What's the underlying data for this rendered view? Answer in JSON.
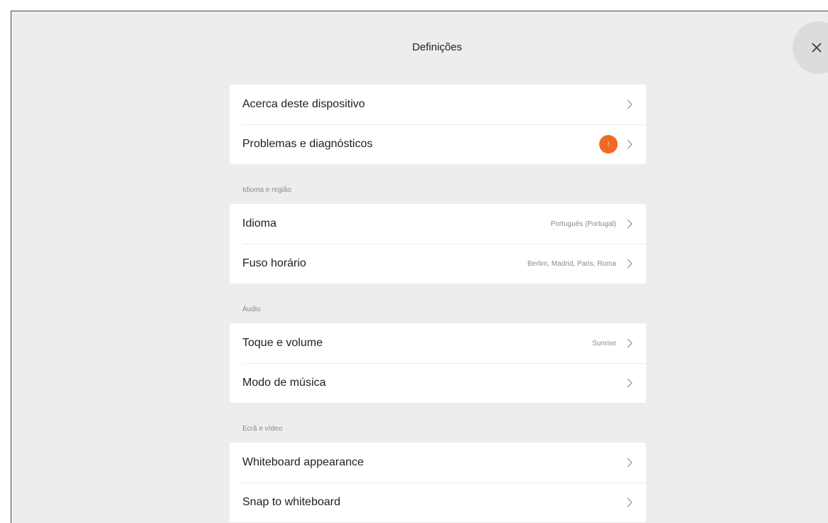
{
  "dialog": {
    "title": "Definições",
    "close_icon": "close-icon"
  },
  "groups": [
    {
      "header": "",
      "rows": [
        {
          "label": "Acerca deste dispositivo",
          "value": ""
        },
        {
          "label": "Problemas e diagnósticos",
          "value": "",
          "badge": "!"
        }
      ]
    },
    {
      "header": "Idioma e região",
      "rows": [
        {
          "label": "Idioma",
          "value": "Português (Portugal)"
        },
        {
          "label": "Fuso horário",
          "value": "Berlim, Madrid, Paris, Roma"
        }
      ]
    },
    {
      "header": "Áudio",
      "rows": [
        {
          "label": "Toque e volume",
          "value": "Sunrise"
        },
        {
          "label": "Modo de música",
          "value": ""
        }
      ]
    },
    {
      "header": "Ecrã e vídeo",
      "rows": [
        {
          "label": "Whiteboard appearance",
          "value": ""
        },
        {
          "label": "Snap to whiteboard",
          "value": ""
        }
      ]
    }
  ],
  "colors": {
    "background": "#ededed",
    "card": "#ffffff",
    "badge": "#f26a21",
    "close_button": "#dcdcdc"
  }
}
